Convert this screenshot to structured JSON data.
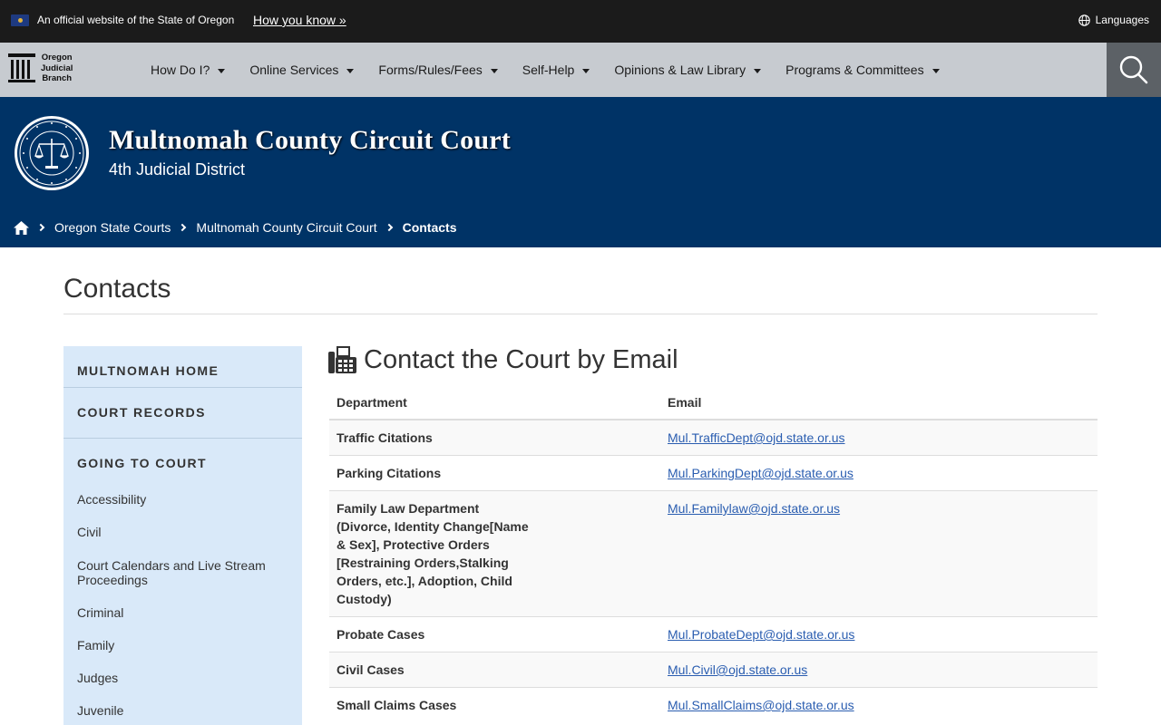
{
  "banner": {
    "official_text": "An official website of the State of Oregon",
    "how_you_know": "How you know »",
    "languages": "Languages"
  },
  "nav": {
    "logo_lines": [
      "Oregon",
      "Judicial",
      "Branch"
    ],
    "items": [
      {
        "label": "How Do I?"
      },
      {
        "label": "Online Services"
      },
      {
        "label": "Forms/Rules/Fees"
      },
      {
        "label": "Self-Help"
      },
      {
        "label": "Opinions & Law Library"
      },
      {
        "label": "Programs & Committees"
      }
    ]
  },
  "header": {
    "court_name": "Multnomah County Circuit Court",
    "district": "4th Judicial District"
  },
  "breadcrumb": {
    "items": [
      "Oregon State Courts",
      "Multnomah County Circuit Court"
    ],
    "current": "Contacts"
  },
  "page": {
    "title": "Contacts"
  },
  "sidebar": {
    "sections": [
      "MULTNOMAH HOME",
      "COURT RECORDS",
      "GOING TO COURT"
    ],
    "links": [
      "Accessibility",
      "Civil",
      "Court Calendars and Live Stream Proceedings",
      "Criminal",
      "Family",
      "Judges",
      "Juvenile"
    ]
  },
  "main": {
    "heading": "Contact the Court by Email",
    "columns": [
      "Department",
      "Email"
    ],
    "rows": [
      {
        "dept": "Traffic Citations",
        "email": "Mul.TrafficDept@ojd.state.or.us"
      },
      {
        "dept": "Parking Citations",
        "email": "Mul.ParkingDept@ojd.state.or.us"
      },
      {
        "dept": "Family Law Department (Divorce, Identity Change[Name & Sex], Protective Orders [Restraining Orders,Stalking Orders, etc.], Adoption, Child Custody)",
        "email": "Mul.Familylaw@ojd.state.or.us"
      },
      {
        "dept": "Probate Cases",
        "email": "Mul.ProbateDept@ojd.state.or.us"
      },
      {
        "dept": "Civil Cases",
        "email": "Mul.Civil@ojd.state.or.us"
      },
      {
        "dept": "Small Claims Cases",
        "email": "Mul.SmallClaims@ojd.state.or.us"
      }
    ]
  },
  "colors": {
    "banner_bg": "#1b1b1b",
    "nav_bg": "#c7cbd0",
    "header_bg": "#003366",
    "sidebar_bg": "#d9e9f9",
    "link": "#2a5db0"
  },
  "icons": {
    "flag": "oregon-flag-icon",
    "globe": "globe-icon",
    "search": "search-icon",
    "home": "home-icon",
    "fax": "fax-icon",
    "seal": "judicial-seal-icon",
    "logo": "pillar-logo-icon"
  }
}
